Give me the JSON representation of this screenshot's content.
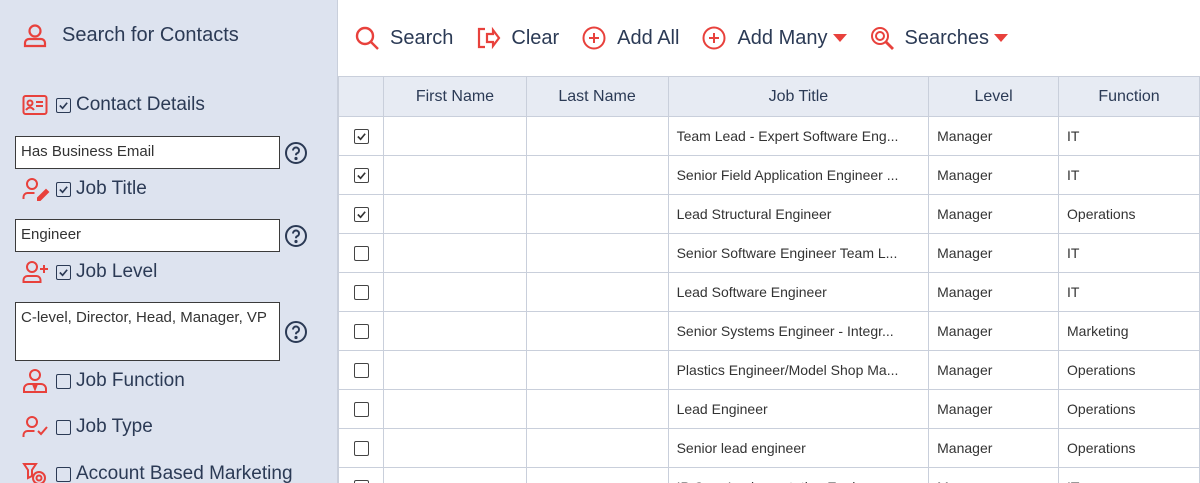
{
  "colors": {
    "accent": "#e8413c",
    "text": "#2b3a55",
    "sidebar_bg": "#dde3ef"
  },
  "sidebar": {
    "header": "Search for Contacts",
    "sections": [
      {
        "label": "Contact Details",
        "checked": true,
        "icon": "id-card-icon"
      },
      {
        "label": "Job Title",
        "checked": true,
        "icon": "user-edit-icon"
      },
      {
        "label": "Job Level",
        "checked": true,
        "icon": "user-plus-icon"
      },
      {
        "label": "Job Function",
        "checked": false,
        "icon": "user-tie-icon"
      },
      {
        "label": "Job Type",
        "checked": false,
        "icon": "user-check-icon"
      },
      {
        "label": "Account Based Marketing",
        "checked": false,
        "icon": "target-icon"
      }
    ],
    "fields": {
      "contact_details": "Has Business Email",
      "job_title": "Engineer",
      "job_level": "C-level, Director, Head, Manager, VP"
    }
  },
  "toolbar": {
    "search": "Search",
    "clear": "Clear",
    "add_all": "Add All",
    "add_many": "Add Many",
    "searches": "Searches"
  },
  "table": {
    "columns": [
      "",
      "First Name",
      "Last Name",
      "Job Title",
      "Level",
      "Function"
    ],
    "rows": [
      {
        "checked": true,
        "first": "",
        "last": "",
        "title": "Team Lead - Expert Software Eng...",
        "level": "Manager",
        "function": "IT"
      },
      {
        "checked": true,
        "first": "",
        "last": "",
        "title": "Senior Field Application Engineer ...",
        "level": "Manager",
        "function": "IT"
      },
      {
        "checked": true,
        "first": "",
        "last": "",
        "title": "Lead Structural Engineer",
        "level": "Manager",
        "function": "Operations"
      },
      {
        "checked": false,
        "first": "",
        "last": "",
        "title": "Senior Software Engineer Team L...",
        "level": "Manager",
        "function": "IT"
      },
      {
        "checked": false,
        "first": "",
        "last": "",
        "title": "Lead Software Engineer",
        "level": "Manager",
        "function": "IT"
      },
      {
        "checked": false,
        "first": "",
        "last": "",
        "title": "Senior Systems Engineer - Integr...",
        "level": "Manager",
        "function": "Marketing"
      },
      {
        "checked": false,
        "first": "",
        "last": "",
        "title": "Plastics Engineer/Model Shop Ma...",
        "level": "Manager",
        "function": "Operations"
      },
      {
        "checked": false,
        "first": "",
        "last": "",
        "title": "Lead Engineer",
        "level": "Manager",
        "function": "Operations"
      },
      {
        "checked": false,
        "first": "",
        "last": "",
        "title": "Senior lead engineer",
        "level": "Manager",
        "function": "Operations"
      },
      {
        "checked": false,
        "first": "",
        "last": "",
        "title": "IP Core Implementation Engineer",
        "level": "Manager",
        "function": "IT"
      }
    ]
  }
}
